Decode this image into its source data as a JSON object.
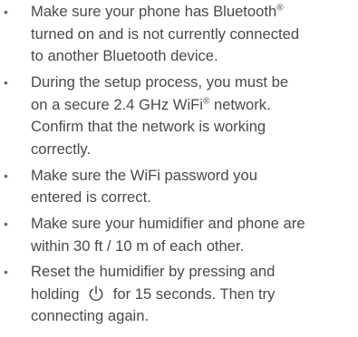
{
  "tips": [
    {
      "lines": [
        [
          "Make sure your phone has Bluetooth",
          "®"
        ],
        [
          "turned on and is not currently connected"
        ],
        [
          "to another Bluetooth device."
        ]
      ]
    },
    {
      "lines": [
        [
          "During the setup process, you must be"
        ],
        [
          "on a secure 2.4 GHz WiFi",
          "®",
          " network."
        ],
        [
          "Confirm that the network is working"
        ],
        [
          "correctly."
        ]
      ]
    },
    {
      "lines": [
        [
          "Make sure the WiFi password you"
        ],
        [
          "entered is correct."
        ]
      ]
    },
    {
      "lines": [
        [
          "Make sure your humidifier and phone are"
        ],
        [
          "within 30 ft / 10 m of each other."
        ]
      ]
    },
    {
      "lines": [
        [
          "Reset the humidifier by pressing and"
        ],
        [
          "holding ",
          "power-icon",
          " for 15 seconds. Then try"
        ],
        [
          "connecting again."
        ]
      ]
    }
  ],
  "bullet_symbol": "•",
  "icons": {
    "power": "power-icon"
  },
  "colors": {
    "text": "#4a4a4a",
    "bullet": "#6a6a6a"
  }
}
